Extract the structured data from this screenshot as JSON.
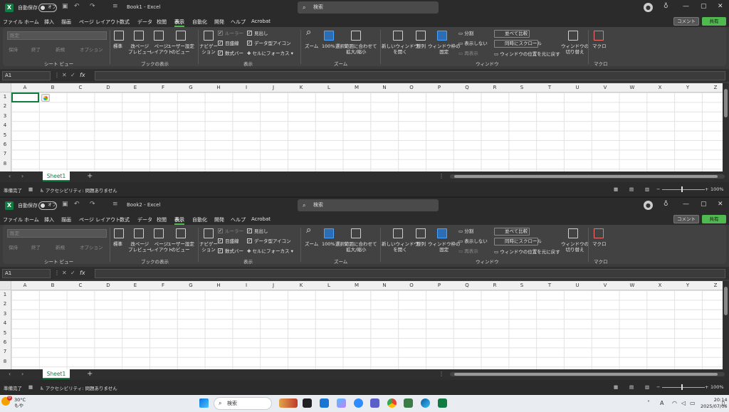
{
  "windows": [
    {
      "id": "w1",
      "title": "Book1 - Excel"
    },
    {
      "id": "w2",
      "title": "Book2 - Excel"
    }
  ],
  "titlebar": {
    "autosave": "自動保存",
    "toggle": "オフ",
    "search": "検索"
  },
  "menu": [
    "ファイル",
    "ホーム",
    "挿入",
    "描画",
    "ページ レイアウト",
    "数式",
    "データ",
    "校閲",
    "表示",
    "自動化",
    "開発",
    "ヘルプ",
    "Acrobat"
  ],
  "menu_active_index": 8,
  "buttons": {
    "comment": "コメント",
    "share": "共有"
  },
  "ribbon": {
    "sheetview": {
      "dropdown": "既定",
      "keep": "保持",
      "exit": "終了",
      "new": "新規",
      "options": "オプション",
      "label": "シート ビュー"
    },
    "bookview": {
      "normal": "標準",
      "pagebreak": "改ページ\nプレビュー",
      "pagelayout": "ページ\nレイアウト",
      "custom": "ユーザー設定\nのビュー",
      "label": "ブックの表示"
    },
    "show": {
      "navigation": "ナビゲー\nション",
      "ruler": "ルーラー",
      "gridlines": "目盛線",
      "formulabar": "数式バー",
      "headings": "見出し",
      "datatype": "データ型アイコン",
      "focus": "セルにフォーカス",
      "label": "表示"
    },
    "zoom": {
      "zoom": "ズーム",
      "z100": "100%",
      "fit": "選択範囲に合わせて\n拡大/縮小",
      "label": "ズーム"
    },
    "window": {
      "newwin": "新しいウィンドウ\nを開く",
      "arrange": "整列",
      "freeze": "ウィンドウ枠の\n固定",
      "split": "分割",
      "hide": "表示しない",
      "unhide": "再表示",
      "compare": "並べて比較",
      "sync": "同時にスクロール",
      "reset": "ウィンドウの位置を元に戻す",
      "switch": "ウィンドウの\n切り替え",
      "label": "ウィンドウ"
    },
    "macro": {
      "macro": "マクロ",
      "label": "マクロ"
    }
  },
  "namebox": "A1",
  "columns": [
    "A",
    "B",
    "C",
    "D",
    "E",
    "F",
    "G",
    "H",
    "I",
    "J",
    "K",
    "L",
    "M",
    "N",
    "O",
    "P",
    "Q",
    "R",
    "S",
    "T",
    "U",
    "V",
    "W",
    "X",
    "Y",
    "Z"
  ],
  "rows": [
    "1",
    "2",
    "3",
    "4",
    "5",
    "6",
    "7",
    "8"
  ],
  "sheet_tab": "Sheet1",
  "status": {
    "ready": "準備完了",
    "accessibility": "アクセシビリティ: 問題ありません",
    "zoom": "100%"
  },
  "taskbar": {
    "temp": "30°C",
    "weather": "もや",
    "badge": "0",
    "search": "検索",
    "time": "20:14",
    "date": "2025/07/06"
  },
  "colors": {
    "excel_green": "#107c41",
    "share_green": "#4fb84f",
    "titlebar": "#2b2b2b",
    "ribbon": "#424242"
  },
  "icons": [
    "excel-logo-icon",
    "save-icon",
    "undo-icon",
    "redo-icon",
    "search-icon",
    "user-avatar-icon",
    "lightbulb-icon",
    "minimize-icon",
    "maximize-icon",
    "close-icon",
    "windows-start-icon"
  ]
}
